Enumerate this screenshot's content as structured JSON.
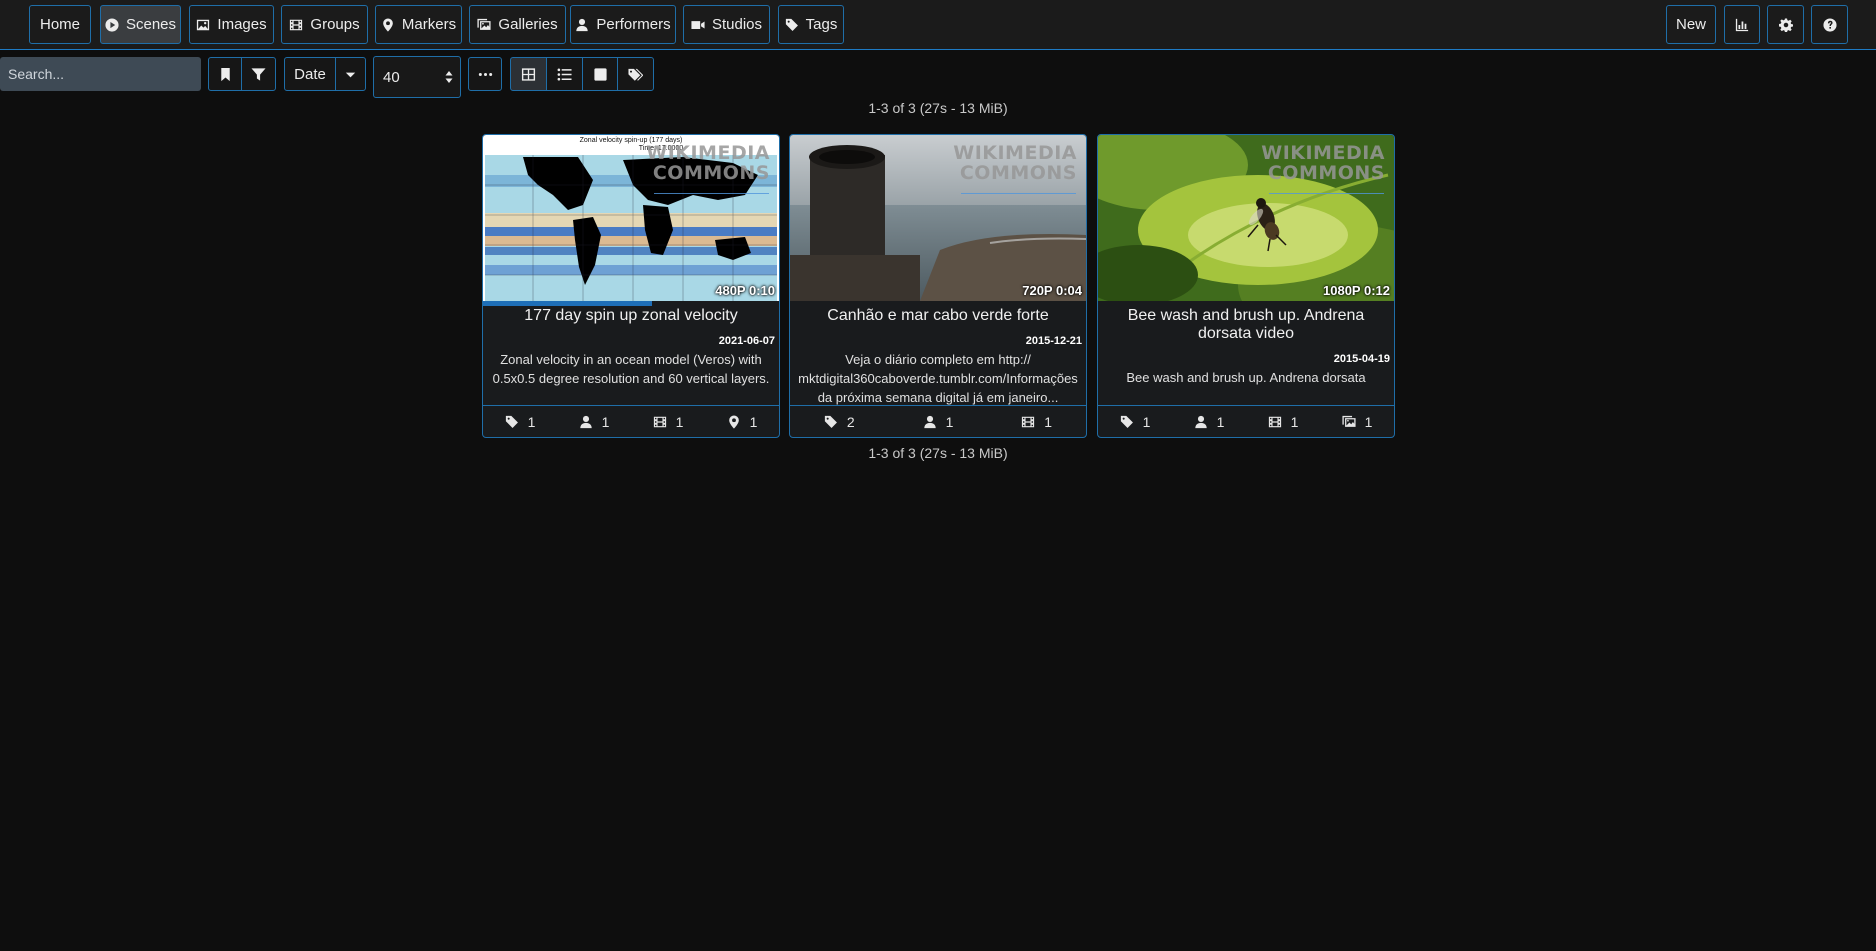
{
  "nav": {
    "home": "Home",
    "scenes": "Scenes",
    "images": "Images",
    "groups": "Groups",
    "markers": "Markers",
    "galleries": "Galleries",
    "performers": "Performers",
    "studios": "Studios",
    "tags": "Tags",
    "new": "New",
    "icons": [
      "play-circle-icon",
      "image-icon",
      "film-icon",
      "map-marker-icon",
      "images-icon",
      "user-icon",
      "video-camera-icon",
      "tag-icon",
      "chart-icon",
      "gear-icon",
      "question-icon"
    ]
  },
  "toolbar": {
    "search_placeholder": "Search...",
    "sort_label": "Date",
    "per_page": "40",
    "view_modes": [
      "grid",
      "list",
      "wall",
      "tagger"
    ],
    "selected_view": "grid"
  },
  "summary": {
    "top": "1-3 of 3 (27s - 13 MiB)",
    "bottom": "1-3 of 3 (27s - 13 MiB)"
  },
  "watermark": {
    "line1": "WIKIMEDIA",
    "line2": "COMMONS"
  },
  "scenes": [
    {
      "title": "177 day spin up zonal velocity",
      "date": "2021-06-07",
      "description": "Zonal velocity in an ocean model (Veros) with 0.5x0.5 degree resolution and 60 vertical layers.",
      "badge": "480P 0:10",
      "thumb_title": "Zonal velocity spin-up (177 days)",
      "thumb_subtitle": "Time: 17.0000",
      "progress": 0.57,
      "stats": [
        {
          "icon": "tag-icon",
          "value": "1"
        },
        {
          "icon": "user-icon",
          "value": "1"
        },
        {
          "icon": "film-icon",
          "value": "1"
        },
        {
          "icon": "map-marker-icon",
          "value": "1"
        }
      ]
    },
    {
      "title": "Canhão e mar cabo verde forte",
      "date": "2015-12-21",
      "description": "Veja o diário completo em http:// mktdigital360caboverde.tumblr.com/Informações da próxima semana digital já em janeiro...",
      "badge": "720P 0:04",
      "progress": 0,
      "stats": [
        {
          "icon": "tag-icon",
          "value": "2"
        },
        {
          "icon": "user-icon",
          "value": "1"
        },
        {
          "icon": "film-icon",
          "value": "1"
        }
      ]
    },
    {
      "title": "Bee wash and brush up. Andrena dorsata video",
      "date": "2015-04-19",
      "description": "Bee wash and brush up. Andrena dorsata",
      "badge": "1080P 0:12",
      "progress": 0,
      "stats": [
        {
          "icon": "tag-icon",
          "value": "1"
        },
        {
          "icon": "user-icon",
          "value": "1"
        },
        {
          "icon": "film-icon",
          "value": "1"
        },
        {
          "icon": "images-icon",
          "value": "1"
        }
      ]
    }
  ]
}
